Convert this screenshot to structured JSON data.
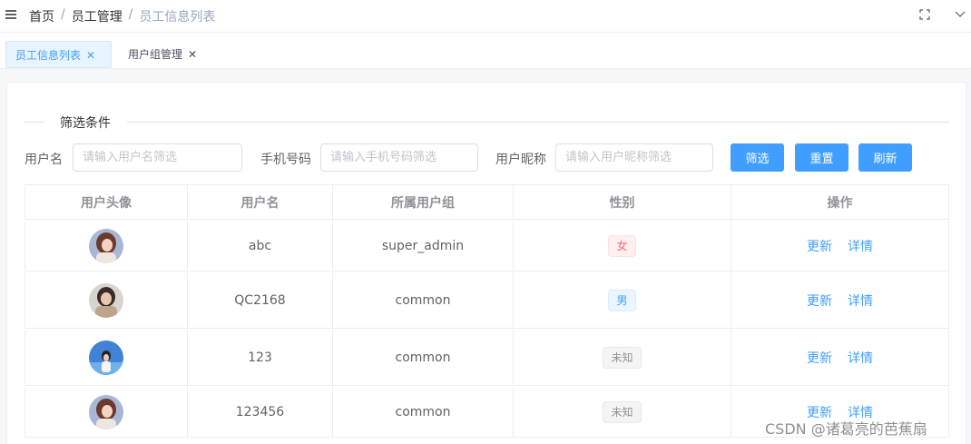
{
  "breadcrumb": [
    "首页",
    "员工管理",
    "员工信息列表"
  ],
  "breadcrumb_sep": "/",
  "tabs": [
    {
      "label": "员工信息列表",
      "close": "✕"
    },
    {
      "label": "用户组管理",
      "close": "✕"
    }
  ],
  "filter": {
    "title": "筛选条件",
    "username_label": "用户名",
    "username_placeholder": "请输入用户名筛选",
    "phone_label": "手机号码",
    "phone_placeholder": "请输入手机号码筛选",
    "nickname_label": "用户昵称",
    "nickname_placeholder": "请输入用户昵称筛选",
    "filter_button": "筛选",
    "reset_button": "重置",
    "refresh_button": "刷新"
  },
  "table": {
    "columns": [
      "用户头像",
      "用户名",
      "所属用户组",
      "性别",
      "操作"
    ],
    "rows": [
      {
        "username": "abc",
        "group": "super_admin",
        "gender": "女",
        "gender_type": "female",
        "update": "更新",
        "detail": "详情"
      },
      {
        "username": "QC2168",
        "group": "common",
        "gender": "男",
        "gender_type": "male",
        "update": "更新",
        "detail": "详情"
      },
      {
        "username": "123",
        "group": "common",
        "gender": "未知",
        "gender_type": "unknown",
        "update": "更新",
        "detail": "详情"
      },
      {
        "username": "123456",
        "group": "common",
        "gender": "未知",
        "gender_type": "unknown",
        "update": "更新",
        "detail": "详情"
      }
    ]
  },
  "colors": {
    "primary": "#409eff",
    "female": "#f56c6c",
    "male": "#409eff",
    "unknown": "#909399"
  },
  "icons": {
    "menu": "hamburger-icon",
    "fullscreen": "fullscreen-icon",
    "dropdown": "chevron-down-icon",
    "tab_close": "close-icon"
  },
  "watermark": "CSDN @诸葛亮的芭蕉扇"
}
